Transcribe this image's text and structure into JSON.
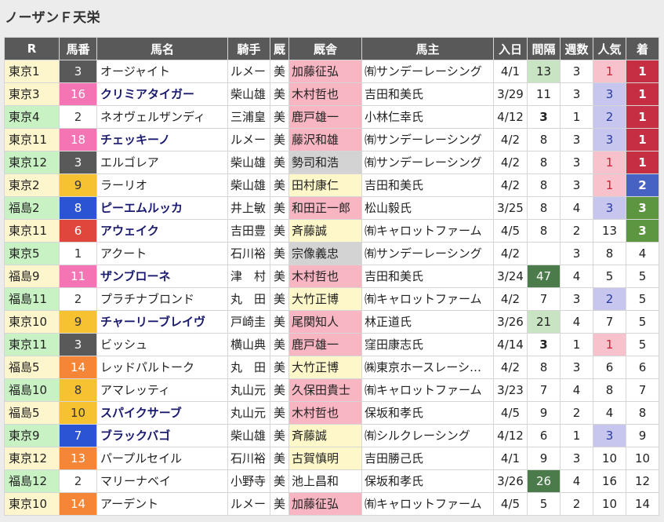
{
  "title": "ノーザンＦ天栄",
  "headers": [
    "R",
    "馬番",
    "馬名",
    "騎手",
    "厩",
    "厩舎",
    "馬主",
    "入日",
    "間隔",
    "週数",
    "人気",
    "着"
  ],
  "colors": {
    "race_tokyo": "#fdf5cc",
    "race_fukushima": "#c9f2c4",
    "stable_pink": "#f8b6c2",
    "stable_yellow": "#fdf7c9",
    "stable_gray": "#d3d3d3",
    "owner_yuu": "#eeeeee",
    "interval_dark": "#4b7a4b",
    "interval_light": "#c9e4c3",
    "pop_pink": "#f8c2cc",
    "pop_blue": "#c6c6ee",
    "finish_red": "#c62e44",
    "finish_blue": "#4663c4",
    "finish_green": "#5c9640"
  },
  "rows": [
    {
      "race": "東京1",
      "race_region": "tokyo",
      "num": "3",
      "num_color": "#595959",
      "num_text": "#ffffff",
      "name": "オージャイト",
      "name_bold": false,
      "jockey": "ルメー",
      "stable_loc": "美",
      "trainer": "加藤征弘",
      "trainer_bg": "pink",
      "owner": "㈲サンデーレーシング",
      "date": "4/1",
      "interval": "13",
      "interval_style": "light",
      "weeks": "3",
      "pop": "1",
      "pop_style": "pink",
      "finish": "1",
      "finish_style": "red"
    },
    {
      "race": "東京3",
      "race_region": "tokyo",
      "num": "16",
      "num_color": "#f375b4",
      "num_text": "#ffffff",
      "name": "クリミアタイガー",
      "name_bold": true,
      "jockey": "柴山雄",
      "stable_loc": "美",
      "trainer": "木村哲也",
      "trainer_bg": "pink",
      "owner": "吉田和美氏",
      "date": "3/29",
      "interval": "11",
      "interval_style": "",
      "weeks": "3",
      "pop": "3",
      "pop_style": "blue",
      "finish": "1",
      "finish_style": "red"
    },
    {
      "race": "東京4",
      "race_region": "fukushima",
      "num": "2",
      "num_color": "#ffffff",
      "num_text": "#333333",
      "name": "ネオヴェルザンディ",
      "name_bold": false,
      "jockey": "三浦皇",
      "stable_loc": "美",
      "trainer": "鹿戸雄一",
      "trainer_bg": "pink",
      "owner": "小林仁幸氏",
      "date": "4/12",
      "interval": "3",
      "interval_style": "bold",
      "weeks": "1",
      "pop": "2",
      "pop_style": "blue",
      "finish": "1",
      "finish_style": "red"
    },
    {
      "race": "東京11",
      "race_region": "tokyo",
      "num": "18",
      "num_color": "#f375b4",
      "num_text": "#ffffff",
      "name": "チェッキーノ",
      "name_bold": true,
      "jockey": "ルメー",
      "stable_loc": "美",
      "trainer": "藤沢和雄",
      "trainer_bg": "pink",
      "owner": "㈲サンデーレーシング",
      "date": "4/2",
      "interval": "8",
      "interval_style": "",
      "weeks": "3",
      "pop": "3",
      "pop_style": "blue",
      "finish": "1",
      "finish_style": "red"
    },
    {
      "race": "東京12",
      "race_region": "fukushima",
      "num": "3",
      "num_color": "#595959",
      "num_text": "#ffffff",
      "name": "エルゴレア",
      "name_bold": false,
      "jockey": "柴山雄",
      "stable_loc": "美",
      "trainer": "勢司和浩",
      "trainer_bg": "gray",
      "owner": "㈲サンデーレーシング",
      "date": "4/2",
      "interval": "8",
      "interval_style": "",
      "weeks": "3",
      "pop": "1",
      "pop_style": "pink",
      "finish": "1",
      "finish_style": "red"
    },
    {
      "race": "東京2",
      "race_region": "tokyo",
      "num": "9",
      "num_color": "#f7c232",
      "num_text": "#333333",
      "name": "ラーリオ",
      "name_bold": false,
      "jockey": "柴山雄",
      "stable_loc": "美",
      "trainer": "田村康仁",
      "trainer_bg": "yellow",
      "owner": "吉田和美氏",
      "date": "4/2",
      "interval": "8",
      "interval_style": "",
      "weeks": "3",
      "pop": "1",
      "pop_style": "pink",
      "finish": "2",
      "finish_style": "blue"
    },
    {
      "race": "福島2",
      "race_region": "fukushima",
      "num": "8",
      "num_color": "#2a54d4",
      "num_text": "#ffffff",
      "name": "ピーエムルッカ",
      "name_bold": true,
      "jockey": "井上敏",
      "stable_loc": "美",
      "trainer": "和田正一郎",
      "trainer_bg": "pink",
      "owner": "松山毅氏",
      "date": "3/25",
      "interval": "8",
      "interval_style": "",
      "weeks": "4",
      "pop": "3",
      "pop_style": "blue",
      "finish": "3",
      "finish_style": "green"
    },
    {
      "race": "東京11",
      "race_region": "tokyo",
      "num": "6",
      "num_color": "#e0463c",
      "num_text": "#ffffff",
      "name": "アウェイク",
      "name_bold": true,
      "jockey": "吉田豊",
      "stable_loc": "美",
      "trainer": "斉藤誠",
      "trainer_bg": "yellow",
      "owner": "㈲キャロットファーム",
      "date": "4/5",
      "interval": "8",
      "interval_style": "",
      "weeks": "2",
      "pop": "13",
      "pop_style": "",
      "finish": "3",
      "finish_style": "green"
    },
    {
      "race": "東京5",
      "race_region": "fukushima",
      "num": "1",
      "num_color": "#ffffff",
      "num_text": "#333333",
      "name": "アクート",
      "name_bold": false,
      "jockey": "石川裕",
      "stable_loc": "美",
      "trainer": "宗像義忠",
      "trainer_bg": "gray",
      "owner": "㈲サンデーレーシング",
      "date": "4/2",
      "interval": "",
      "interval_style": "",
      "weeks": "3",
      "pop": "8",
      "pop_style": "",
      "finish": "4",
      "finish_style": ""
    },
    {
      "race": "福島9",
      "race_region": "tokyo",
      "num": "11",
      "num_color": "#f375b4",
      "num_text": "#ffffff",
      "name": "ザンブローネ",
      "name_bold": true,
      "jockey": "津　村",
      "stable_loc": "美",
      "trainer": "木村哲也",
      "trainer_bg": "pink",
      "owner": "吉田和美氏",
      "date": "3/24",
      "interval": "47",
      "interval_style": "dark",
      "weeks": "4",
      "pop": "5",
      "pop_style": "",
      "finish": "5",
      "finish_style": ""
    },
    {
      "race": "福島11",
      "race_region": "fukushima",
      "num": "2",
      "num_color": "#ffffff",
      "num_text": "#333333",
      "name": "プラチナブロンド",
      "name_bold": false,
      "jockey": "丸　田",
      "stable_loc": "美",
      "trainer": "大竹正博",
      "trainer_bg": "yellow",
      "owner": "㈲キャロットファーム",
      "date": "4/2",
      "interval": "7",
      "interval_style": "",
      "weeks": "3",
      "pop": "2",
      "pop_style": "blue",
      "finish": "5",
      "finish_style": ""
    },
    {
      "race": "東京10",
      "race_region": "tokyo",
      "num": "9",
      "num_color": "#f7c232",
      "num_text": "#333333",
      "name": "チャーリーブレイヴ",
      "name_bold": true,
      "jockey": "戸崎圭",
      "stable_loc": "美",
      "trainer": "尾関知人",
      "trainer_bg": "pink",
      "owner": "林正道氏",
      "date": "3/26",
      "interval": "21",
      "interval_style": "light",
      "weeks": "4",
      "pop": "7",
      "pop_style": "",
      "finish": "5",
      "finish_style": ""
    },
    {
      "race": "東京11",
      "race_region": "fukushima",
      "num": "3",
      "num_color": "#595959",
      "num_text": "#ffffff",
      "name": "ビッシュ",
      "name_bold": false,
      "jockey": "横山典",
      "stable_loc": "美",
      "trainer": "鹿戸雄一",
      "trainer_bg": "pink",
      "owner": "窪田康志氏",
      "date": "4/14",
      "interval": "3",
      "interval_style": "bold",
      "weeks": "1",
      "pop": "1",
      "pop_style": "pink",
      "finish": "5",
      "finish_style": ""
    },
    {
      "race": "福島5",
      "race_region": "tokyo",
      "num": "14",
      "num_color": "#f58638",
      "num_text": "#ffffff",
      "name": "レッドパルトーク",
      "name_bold": false,
      "jockey": "丸　田",
      "stable_loc": "美",
      "trainer": "大竹正博",
      "trainer_bg": "yellow",
      "owner": "㈱東京ホースレーシ…",
      "date": "4/2",
      "interval": "8",
      "interval_style": "",
      "weeks": "3",
      "pop": "6",
      "pop_style": "",
      "finish": "6",
      "finish_style": ""
    },
    {
      "race": "福島10",
      "race_region": "fukushima",
      "num": "8",
      "num_color": "#f7c232",
      "num_text": "#333333",
      "name": "アマレッティ",
      "name_bold": false,
      "jockey": "丸山元",
      "stable_loc": "美",
      "trainer": "久保田貴士",
      "trainer_bg": "pink",
      "owner": "㈲キャロットファーム",
      "date": "3/23",
      "interval": "7",
      "interval_style": "",
      "weeks": "4",
      "pop": "8",
      "pop_style": "",
      "finish": "7",
      "finish_style": ""
    },
    {
      "race": "福島5",
      "race_region": "tokyo",
      "num": "10",
      "num_color": "#f7c232",
      "num_text": "#333333",
      "name": "スパイクサーブ",
      "name_bold": true,
      "jockey": "丸山元",
      "stable_loc": "美",
      "trainer": "木村哲也",
      "trainer_bg": "pink",
      "owner": "保坂和孝氏",
      "date": "4/5",
      "interval": "9",
      "interval_style": "",
      "weeks": "2",
      "pop": "4",
      "pop_style": "",
      "finish": "8",
      "finish_style": ""
    },
    {
      "race": "東京9",
      "race_region": "fukushima",
      "num": "7",
      "num_color": "#2a54d4",
      "num_text": "#ffffff",
      "name": "ブラックバゴ",
      "name_bold": true,
      "jockey": "柴山雄",
      "stable_loc": "美",
      "trainer": "斉藤誠",
      "trainer_bg": "yellow",
      "owner": "㈲シルクレーシング",
      "date": "4/12",
      "interval": "6",
      "interval_style": "",
      "weeks": "1",
      "pop": "3",
      "pop_style": "blue",
      "finish": "9",
      "finish_style": ""
    },
    {
      "race": "東京12",
      "race_region": "tokyo",
      "num": "13",
      "num_color": "#f58638",
      "num_text": "#ffffff",
      "name": "パープルセイル",
      "name_bold": false,
      "jockey": "石川裕",
      "stable_loc": "美",
      "trainer": "古賀慎明",
      "trainer_bg": "yellow",
      "owner": "吉田勝己氏",
      "date": "4/1",
      "interval": "9",
      "interval_style": "",
      "weeks": "3",
      "pop": "10",
      "pop_style": "",
      "finish": "10",
      "finish_style": ""
    },
    {
      "race": "福島12",
      "race_region": "fukushima",
      "num": "2",
      "num_color": "#ffffff",
      "num_text": "#333333",
      "name": "マリーナベイ",
      "name_bold": false,
      "jockey": "小野寺",
      "stable_loc": "美",
      "trainer": "池上昌和",
      "trainer_bg": "none",
      "owner": "保坂和孝氏",
      "date": "3/26",
      "interval": "26",
      "interval_style": "dark",
      "weeks": "4",
      "pop": "16",
      "pop_style": "",
      "finish": "12",
      "finish_style": ""
    },
    {
      "race": "東京10",
      "race_region": "tokyo",
      "num": "14",
      "num_color": "#f58638",
      "num_text": "#ffffff",
      "name": "アーデント",
      "name_bold": false,
      "jockey": "ルメー",
      "stable_loc": "美",
      "trainer": "加藤征弘",
      "trainer_bg": "pink",
      "owner": "㈲キャロットファーム",
      "date": "4/5",
      "interval": "5",
      "interval_style": "",
      "weeks": "2",
      "pop": "10",
      "pop_style": "",
      "finish": "14",
      "finish_style": ""
    }
  ]
}
